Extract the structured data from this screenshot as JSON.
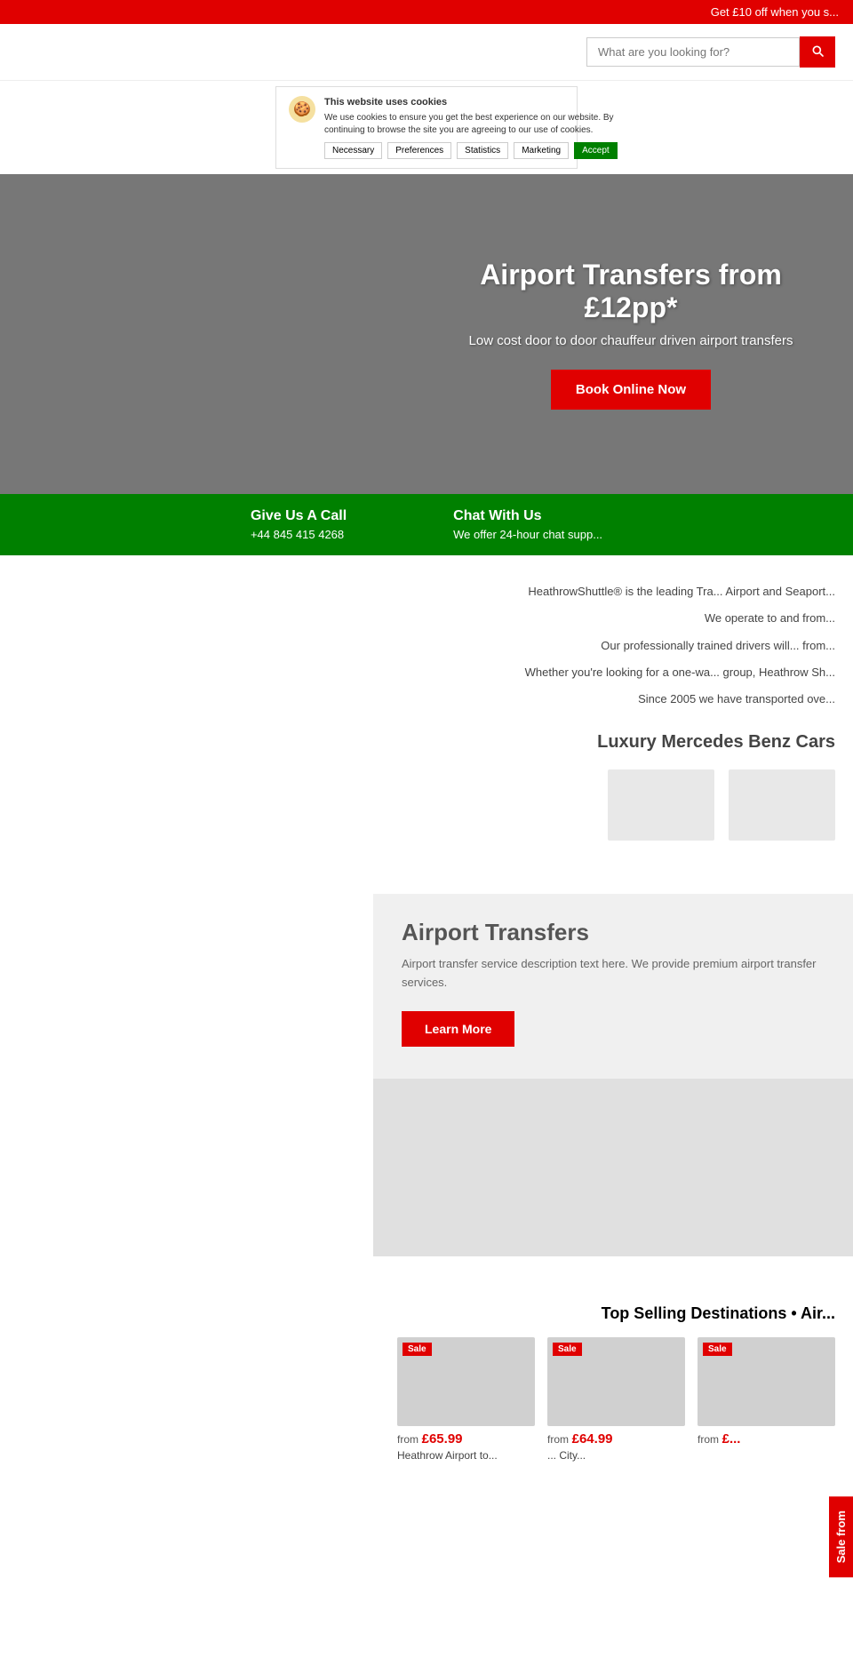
{
  "topBanner": {
    "text": "Get £10 off when you s..."
  },
  "header": {
    "searchPlaceholder": "What are you looking for?"
  },
  "cookieNotice": {
    "title": "This website uses cookies",
    "body": "We use cookies to ensure you get the best experience on our website. By continuing to browse the site you are agreeing to our use of cookies.",
    "btns": [
      "Necessary",
      "Preferences",
      "Statistics",
      "Marketing"
    ],
    "acceptLabel": "Accept"
  },
  "hero": {
    "title": "Airport Transfers from £12pp*",
    "subtitle": "Low cost door to door chauffeur driven airport transfers",
    "btnLabel": "Book Online Now"
  },
  "greenBar": {
    "item1": {
      "heading": "Give Us A Call",
      "phone": "+44 845 415 4268"
    },
    "item2": {
      "heading": "Chat With Us",
      "desc": "We offer 24-hour chat supp..."
    }
  },
  "about": {
    "lines": [
      "HeathrowShuttle® is the leading Tra... Airport and Seaport...",
      "We operate to and from...",
      "Our professionally trained drivers will... from...",
      "Whether you're looking for a one-wa... group, Heathrow Sh...",
      "Since 2005 we have transported ove..."
    ],
    "carsTitle": "Luxury Mercedes Benz Cars",
    "cars": [
      "car1",
      "car2"
    ]
  },
  "services": {
    "cardTitle": "Airport Transfers",
    "cardDesc": "Airport transfer service description text here. We provide premium airport transfer services.",
    "learnMoreLabel": "Learn More"
  },
  "destinations": {
    "title": "Top Selling Destinations • Air...",
    "cards": [
      {
        "sale": true,
        "fromLabel": "from",
        "price": "£65.99",
        "name": "Heathrow Airport to..."
      },
      {
        "sale": true,
        "fromLabel": "from",
        "price": "£64.99",
        "name": "... City..."
      },
      {
        "sale": true,
        "fromLabel": "from",
        "price": "£..."
      }
    ]
  },
  "saleSidebar": {
    "text": "Sale from"
  }
}
